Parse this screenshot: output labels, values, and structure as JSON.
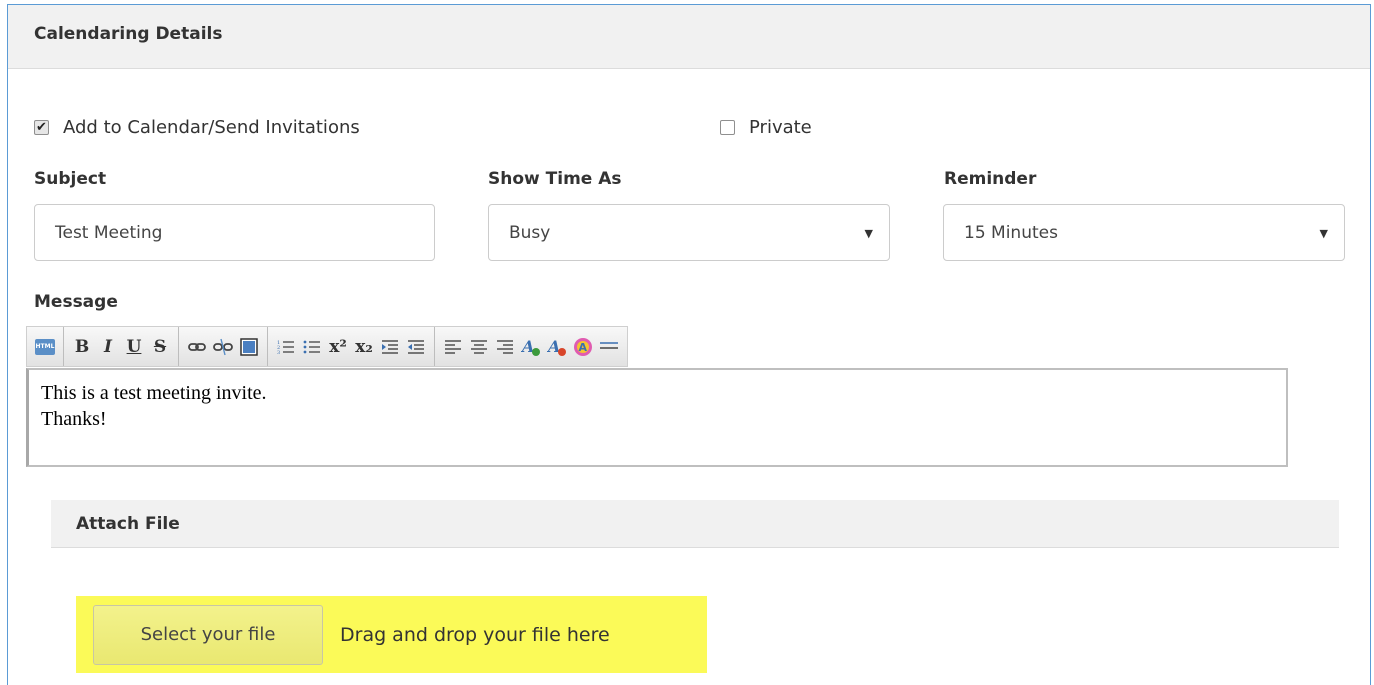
{
  "panel": {
    "title": "Calendaring Details"
  },
  "options": {
    "add_to_calendar": {
      "label": "Add to Calendar/Send Invitations",
      "checked": true
    },
    "private": {
      "label": "Private",
      "checked": false
    }
  },
  "subject": {
    "label": "Subject",
    "value": "Test Meeting"
  },
  "show_time_as": {
    "label": "Show Time As",
    "value": "Busy"
  },
  "reminder": {
    "label": "Reminder",
    "value": "15 Minutes"
  },
  "message": {
    "label": "Message",
    "line1": "This is a test meeting invite.",
    "line2": "Thanks!"
  },
  "toolbar": {
    "html": "HTML",
    "bold": "B",
    "italic": "I",
    "underline": "U",
    "strike": "S",
    "superscript": "x²",
    "subscript": "x₂",
    "icons": [
      "html-icon",
      "bold-icon",
      "italic-icon",
      "underline-icon",
      "strikethrough-icon",
      "link-icon",
      "unlink-icon",
      "image-icon",
      "ordered-list-icon",
      "unordered-list-icon",
      "superscript-icon",
      "subscript-icon",
      "indent-icon",
      "outdent-icon",
      "align-left-icon",
      "align-center-icon",
      "align-right-icon",
      "font-color-icon",
      "highlight-color-icon",
      "font-icon",
      "horizontal-rule-icon"
    ]
  },
  "attach": {
    "title": "Attach File",
    "select_label": "Select your file",
    "drop_text": "Drag and drop your file here",
    "highlight_color": "#fbfa58"
  },
  "colors": {
    "panel_border": "#5b9bd5",
    "header_bg": "#f1f1f1"
  }
}
